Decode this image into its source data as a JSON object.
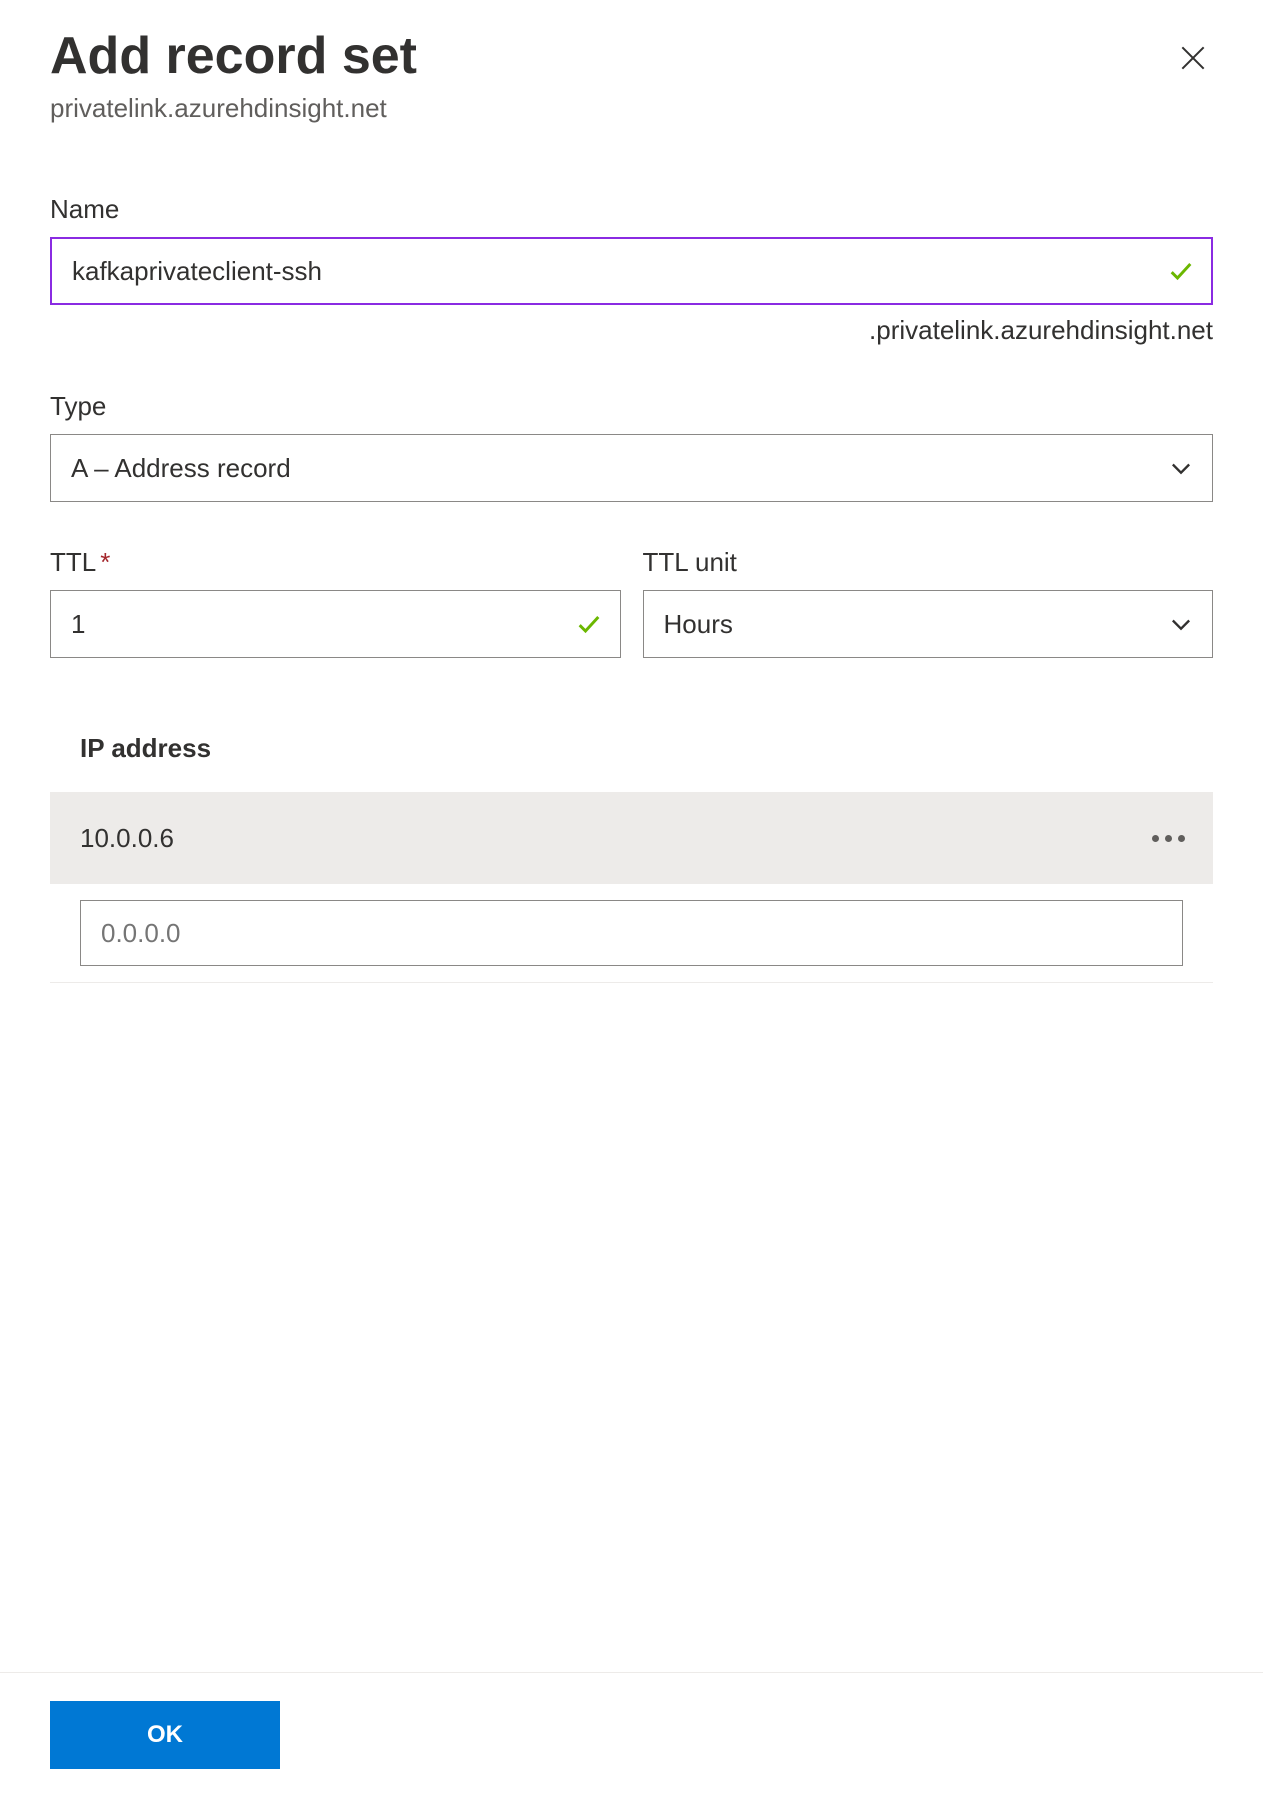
{
  "header": {
    "title": "Add record set",
    "subtitle": "privatelink.azurehdinsight.net"
  },
  "fields": {
    "name": {
      "label": "Name",
      "value": "kafkaprivateclient-ssh",
      "suffix": ".privatelink.azurehdinsight.net"
    },
    "type": {
      "label": "Type",
      "value": "A – Address record"
    },
    "ttl": {
      "label": "TTL",
      "value": "1"
    },
    "ttlUnit": {
      "label": "TTL unit",
      "value": "Hours"
    }
  },
  "ipAddress": {
    "header": "IP address",
    "entries": [
      "10.0.0.6"
    ],
    "placeholder": "0.0.0.0"
  },
  "footer": {
    "okLabel": "OK"
  }
}
